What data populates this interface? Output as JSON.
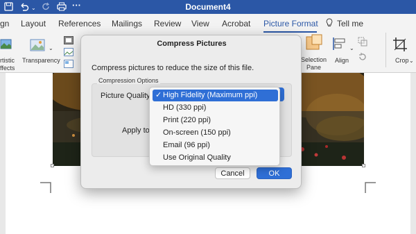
{
  "titlebar": {
    "document_title": "Document4",
    "icons": [
      "save-icon",
      "undo-icon",
      "redo-icon",
      "print-icon",
      "more-icon"
    ]
  },
  "tabs": [
    {
      "label": "gn"
    },
    {
      "label": "Layout"
    },
    {
      "label": "References"
    },
    {
      "label": "Mailings"
    },
    {
      "label": "Review"
    },
    {
      "label": "View"
    },
    {
      "label": "Acrobat"
    },
    {
      "label": "Picture Format",
      "active": true
    },
    {
      "label": "Tell me"
    }
  ],
  "ribbon": {
    "artistic_effects": "rtistic\nffects",
    "transparency": "Transparency",
    "selection_pane": "Selection\nPane",
    "align": "Align",
    "crop": "Crop"
  },
  "dialog": {
    "title": "Compress Pictures",
    "description": "Compress pictures to reduce the size of this file.",
    "group_label": "Compression Options",
    "picture_quality_label": "Picture Quality",
    "apply_to_label": "Apply to",
    "cancel_label": "Cancel",
    "ok_label": "OK"
  },
  "menu": {
    "items": [
      {
        "label": "High Fidelity (Maximum ppi)",
        "selected": true,
        "check": "✓"
      },
      {
        "label": "HD (330 ppi)"
      },
      {
        "label": "Print (220 ppi)"
      },
      {
        "label": "On-screen (150 ppi)"
      },
      {
        "label": "Email (96 ppi)"
      },
      {
        "label": "Use Original Quality"
      }
    ]
  },
  "colors": {
    "accent": "#2b57a6",
    "selection": "#2f6fd6"
  }
}
